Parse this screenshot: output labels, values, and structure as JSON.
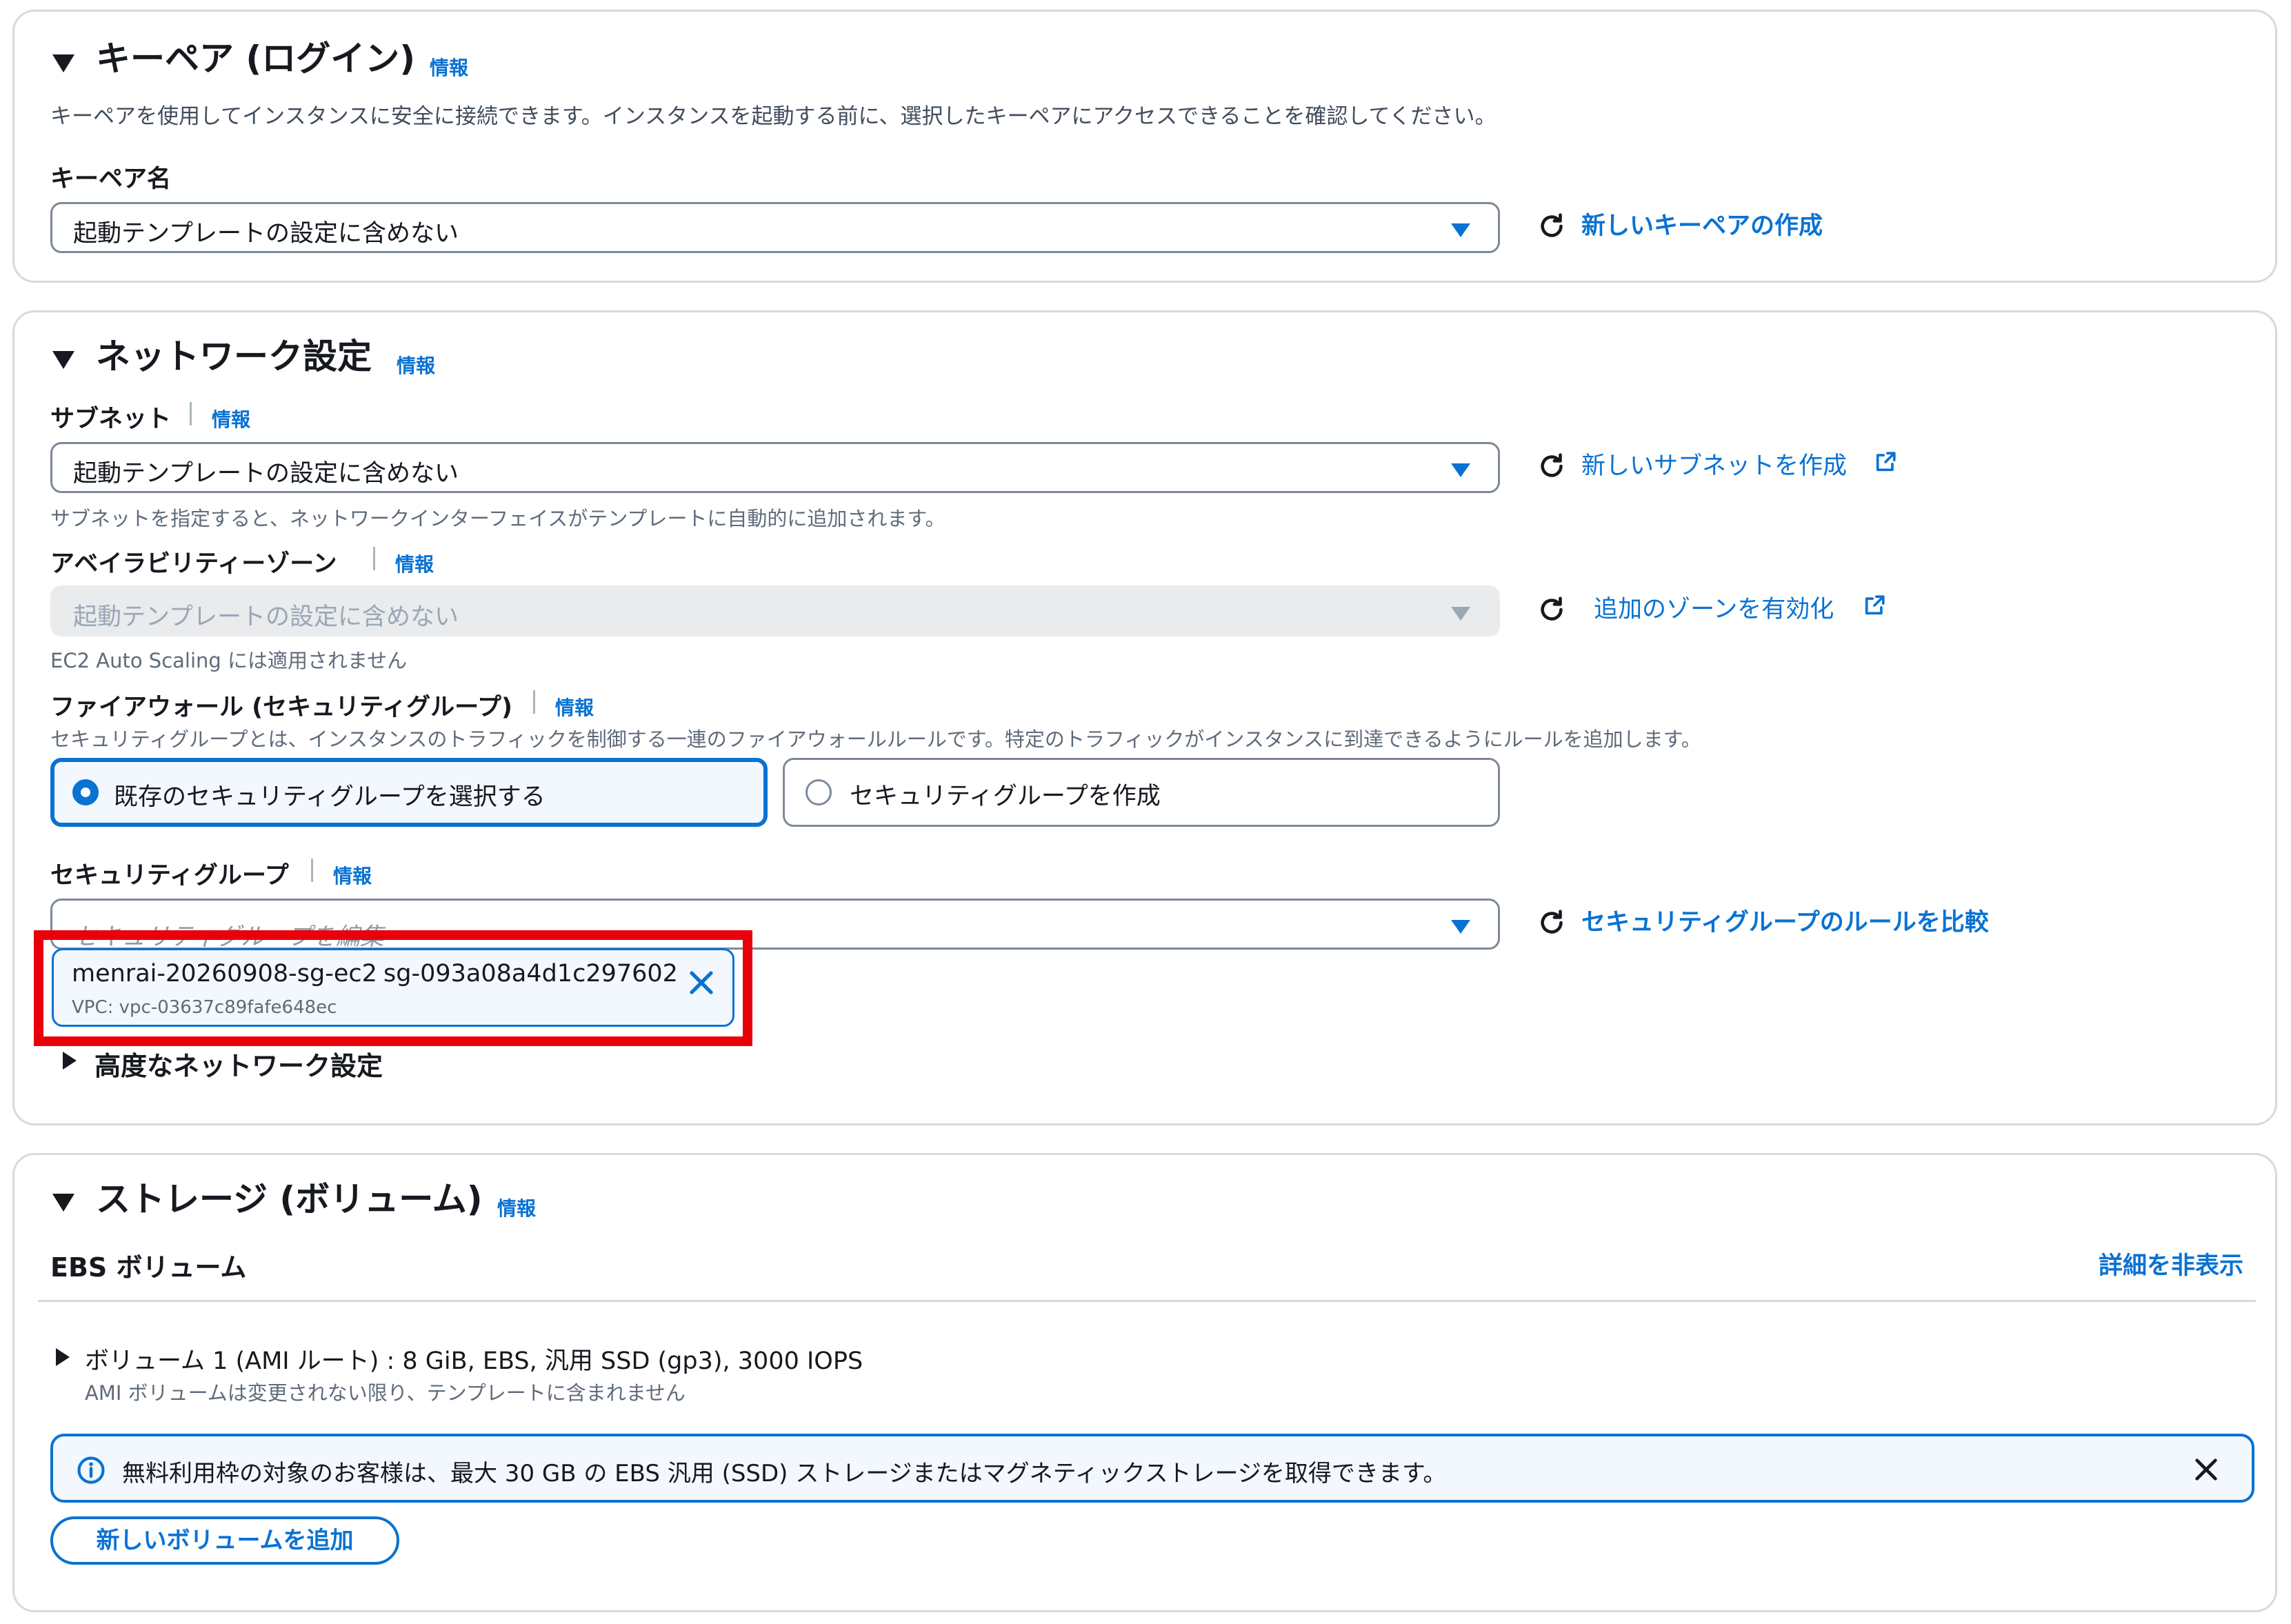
{
  "info_label": "情報",
  "keypair": {
    "title": "キーペア (ログイン)",
    "description": "キーペアを使用してインスタンスに安全に接続できます。インスタンスを起動する前に、選択したキーペアにアクセスできることを確認してください。",
    "name_label": "キーペア名",
    "select_value": "起動テンプレートの設定に含めない",
    "create_link": "新しいキーペアの作成"
  },
  "network": {
    "title": "ネットワーク設定",
    "subnet_label": "サブネット",
    "subnet_value": "起動テンプレートの設定に含めない",
    "subnet_link": "新しいサブネットを作成",
    "subnet_help": "サブネットを指定すると、ネットワークインターフェイスがテンプレートに自動的に追加されます。",
    "az_label": "アベイラビリティーゾーン",
    "az_value": "起動テンプレートの設定に含めない",
    "az_link": "追加のゾーンを有効化",
    "az_help": "EC2 Auto Scaling には適用されません",
    "firewall_label": "ファイアウォール (セキュリティグループ)",
    "firewall_desc": "セキュリティグループとは、インスタンスのトラフィックを制御する一連のファイアウォールルールです。特定のトラフィックがインスタンスに到達できるようにルールを追加します。",
    "option_existing": "既存のセキュリティグループを選択する",
    "option_create": "セキュリティグループを作成",
    "sg_label": "セキュリティグループ",
    "sg_placeholder": "セキュリティグループを編集",
    "sg_compare_link": "セキュリティグループのルールを比較",
    "sg_token_name": "menrai-20260908-sg-ec2",
    "sg_token_id": "sg-093a08a4d1c297602",
    "sg_token_vpc": "VPC: vpc-03637c89fafe648ec",
    "advanced_label": "高度なネットワーク設定"
  },
  "storage": {
    "title": "ストレージ (ボリューム)",
    "ebs_label": "EBS ボリューム",
    "hide_details": "詳細を非表示",
    "volume_summary": "ボリューム 1 (AMI ルート) : 8 GiB, EBS, 汎用 SSD (gp3), 3000 IOPS",
    "volume_note": "AMI ボリュームは変更されない限り、テンプレートに含まれません",
    "free_tier_alert": "無料利用枠の対象のお客様は、最大 30 GB の EBS 汎用 (SSD) ストレージまたはマグネティックストレージを取得できます。",
    "add_volume_button": "新しいボリュームを追加"
  },
  "colors": {
    "accent": "#0972d3",
    "highlight": "#e8000a",
    "border": "#d5dbdb"
  }
}
